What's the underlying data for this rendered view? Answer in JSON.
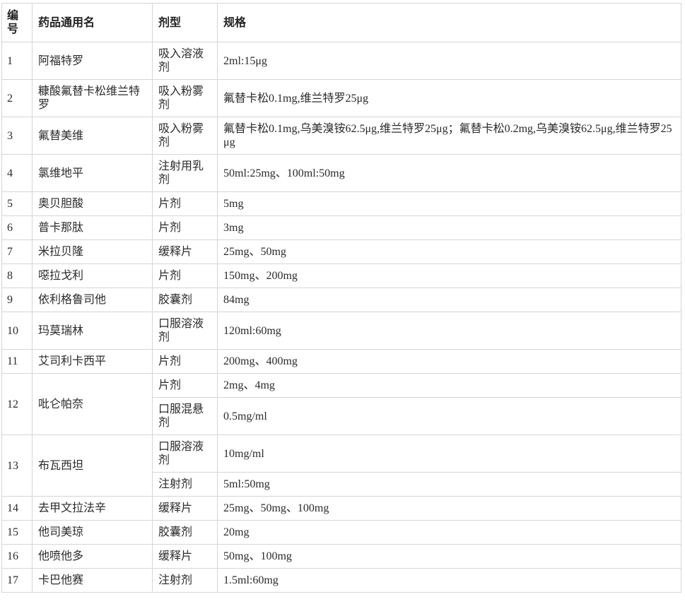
{
  "table": {
    "headers": {
      "id": "编号",
      "name": "药品通用名",
      "form": "剂型",
      "spec": "规格"
    },
    "rows": [
      {
        "id": "1",
        "name": "阿福特罗",
        "entries": [
          {
            "form": "吸入溶液剂",
            "spec": "2ml:15μg"
          }
        ]
      },
      {
        "id": "2",
        "name": "糠酸氟替卡松维兰特罗",
        "entries": [
          {
            "form": "吸入粉雾剂",
            "spec": "氟替卡松0.1mg,维兰特罗25μg"
          }
        ]
      },
      {
        "id": "3",
        "name": "氟替美维",
        "entries": [
          {
            "form": "吸入粉雾剂",
            "spec": "氟替卡松0.1mg,乌美溴铵62.5μg,维兰特罗25μg；氟替卡松0.2mg,乌美溴铵62.5μg,维兰特罗25μg"
          }
        ]
      },
      {
        "id": "4",
        "name": "氯维地平",
        "entries": [
          {
            "form": "注射用乳剂",
            "spec": "50ml:25mg、100ml:50mg"
          }
        ]
      },
      {
        "id": "5",
        "name": "奥贝胆酸",
        "entries": [
          {
            "form": "片剂",
            "spec": "5mg"
          }
        ]
      },
      {
        "id": "6",
        "name": "普卡那肽",
        "entries": [
          {
            "form": "片剂",
            "spec": "3mg"
          }
        ]
      },
      {
        "id": "7",
        "name": "米拉贝隆",
        "entries": [
          {
            "form": "缓释片",
            "spec": "25mg、50mg"
          }
        ]
      },
      {
        "id": "8",
        "name": "噁拉戈利",
        "entries": [
          {
            "form": "片剂",
            "spec": "150mg、200mg"
          }
        ]
      },
      {
        "id": "9",
        "name": "依利格鲁司他",
        "entries": [
          {
            "form": "胶囊剂",
            "spec": "84mg"
          }
        ]
      },
      {
        "id": "10",
        "name": "玛莫瑞林",
        "entries": [
          {
            "form": "口服溶液剂",
            "spec": "120ml:60mg"
          }
        ]
      },
      {
        "id": "11",
        "name": "艾司利卡西平",
        "entries": [
          {
            "form": "片剂",
            "spec": "200mg、400mg"
          }
        ]
      },
      {
        "id": "12",
        "name": "吡仑帕奈",
        "entries": [
          {
            "form": "片剂",
            "spec": "2mg、4mg"
          },
          {
            "form": "口服混悬剂",
            "spec": "0.5mg/ml"
          }
        ]
      },
      {
        "id": "13",
        "name": "布瓦西坦",
        "entries": [
          {
            "form": "口服溶液剂",
            "spec": "10mg/ml"
          },
          {
            "form": "注射剂",
            "spec": "5ml:50mg"
          }
        ]
      },
      {
        "id": "14",
        "name": "去甲文拉法辛",
        "entries": [
          {
            "form": "缓释片",
            "spec": "25mg、50mg、100mg"
          }
        ]
      },
      {
        "id": "15",
        "name": "他司美琼",
        "entries": [
          {
            "form": "胶囊剂",
            "spec": "20mg"
          }
        ]
      },
      {
        "id": "16",
        "name": "他喷他多",
        "entries": [
          {
            "form": "缓释片",
            "spec": "50mg、100mg"
          }
        ]
      },
      {
        "id": "17",
        "name": "卡巴他赛",
        "entries": [
          {
            "form": "注射剂",
            "spec": "1.5ml:60mg"
          }
        ]
      }
    ]
  }
}
